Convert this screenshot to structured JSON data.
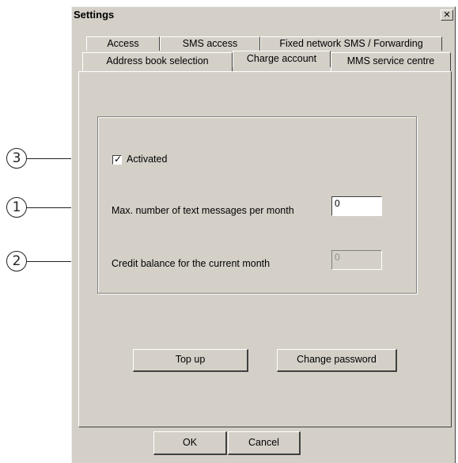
{
  "callouts": {
    "activated": "3",
    "max_messages": "1",
    "credit_balance": "2"
  },
  "window": {
    "title": "Settings",
    "close_glyph": "✕"
  },
  "tabs": {
    "row_back": [
      "Access",
      "SMS access",
      "Fixed network SMS / Forwarding"
    ],
    "row_front": [
      "Address book selection",
      "Charge account",
      "MMS service centre"
    ],
    "active": "Charge account"
  },
  "form": {
    "activated_label": "Activated",
    "activated_checked": true,
    "max_label": "Max. number of text messages per month",
    "max_value": "0",
    "credit_label": "Credit balance for the current month",
    "credit_value": "0"
  },
  "buttons": {
    "top_up": "Top up",
    "change_password": "Change password",
    "ok": "OK",
    "cancel": "Cancel"
  }
}
